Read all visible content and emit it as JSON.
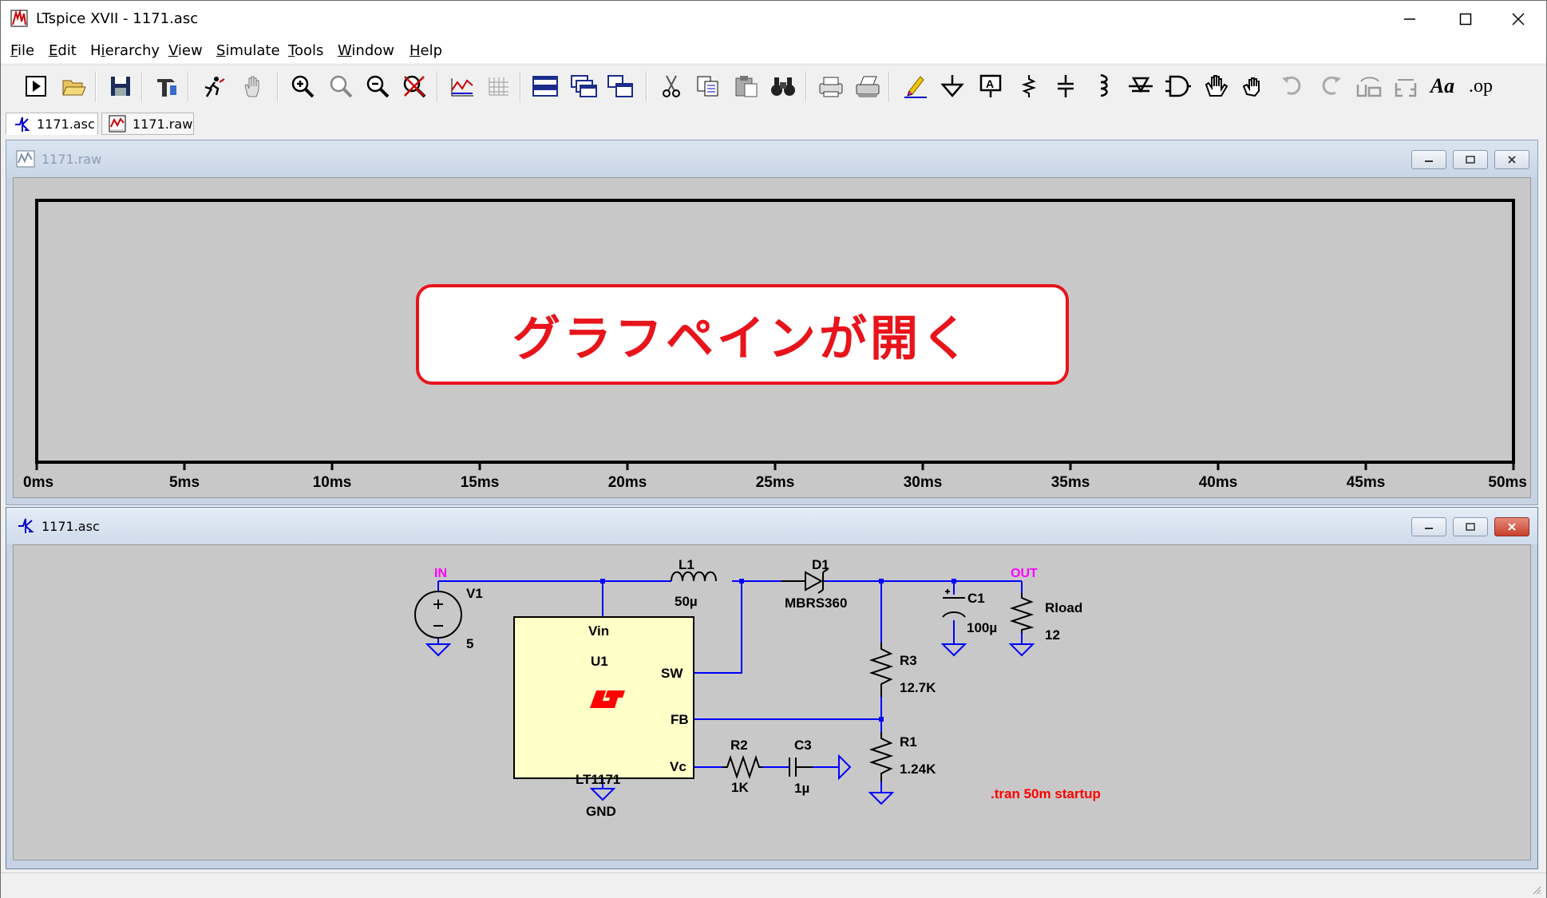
{
  "window": {
    "title": "LTspice XVII - 1171.asc"
  },
  "menu": [
    {
      "label": "File",
      "key": "F"
    },
    {
      "label": "Edit",
      "key": "E"
    },
    {
      "label": "Hierarchy",
      "key": "i"
    },
    {
      "label": "View",
      "key": "V"
    },
    {
      "label": "Simulate",
      "key": "S"
    },
    {
      "label": "Tools",
      "key": "T"
    },
    {
      "label": "Window",
      "key": "W"
    },
    {
      "label": "Help",
      "key": "H"
    }
  ],
  "toolbar": {
    "icons": [
      "run-icon",
      "open-icon",
      "save-icon",
      "control-panel-icon",
      "halt-icon",
      "pan-icon",
      "zoom-in-icon",
      "zoom-area-icon",
      "zoom-out-icon",
      "zoom-fit-icon",
      "autorange-icon",
      "grid-icon",
      "tile-horizontal-icon",
      "cascade-icon",
      "tile-vertical-icon",
      "cut-icon",
      "copy-icon",
      "paste-icon",
      "find-icon",
      "print-preview-icon",
      "print-icon",
      "draw-wire-icon",
      "ground-icon",
      "label-net-icon",
      "resistor-icon",
      "capacitor-icon",
      "inductor-icon",
      "diode-icon",
      "component-icon",
      "move-icon",
      "drag-icon",
      "undo-icon",
      "redo-icon",
      "rotate-icon",
      "mirror-icon",
      "text-icon",
      "spice-directive-icon"
    ],
    "text_label": "Aa",
    "op_label": ".op"
  },
  "tabs": [
    {
      "label": "1171.asc",
      "icon": "schematic-icon"
    },
    {
      "label": "1171.raw",
      "icon": "waveform-icon"
    }
  ],
  "waveform_window": {
    "title": "1171.raw",
    "chart_data": {
      "type": "line",
      "series": [],
      "x_ticks": [
        "0ms",
        "5ms",
        "10ms",
        "15ms",
        "20ms",
        "25ms",
        "30ms",
        "35ms",
        "40ms",
        "45ms",
        "50ms"
      ],
      "xlim": [
        0,
        50
      ],
      "x_unit": "ms"
    }
  },
  "callout": "グラフペインが開く",
  "schematic_window": {
    "title": "1171.asc",
    "labels": {
      "net_in": "IN",
      "net_out": "OUT",
      "v1": "V1",
      "v1_val": "5",
      "l1": "L1",
      "l1_val": "50µ",
      "d1": "D1",
      "d1_val": "MBRS360",
      "c1": "C1",
      "c1_val": "100µ",
      "rload": "Rload",
      "rload_val": "12",
      "r3": "R3",
      "r3_val": "12.7K",
      "r1": "R1",
      "r1_val": "1.24K",
      "r2": "R2",
      "r2_val": "1K",
      "c3": "C3",
      "c3_val": "1µ",
      "u1_vin": "Vin",
      "u1_name": "U1",
      "u1_sw": "SW",
      "u1_fb": "FB",
      "u1_vc": "Vc",
      "u1_part": "LT1171",
      "u1_gnd": "GND",
      "directive": ".tran 50m startup"
    },
    "colors": {
      "wire": "#0000ff",
      "component": "#000000",
      "ic_fill": "#ffffc8",
      "directive": "#ff0000",
      "net": "#ff00ff",
      "lt_logo": "#ff0000"
    }
  }
}
